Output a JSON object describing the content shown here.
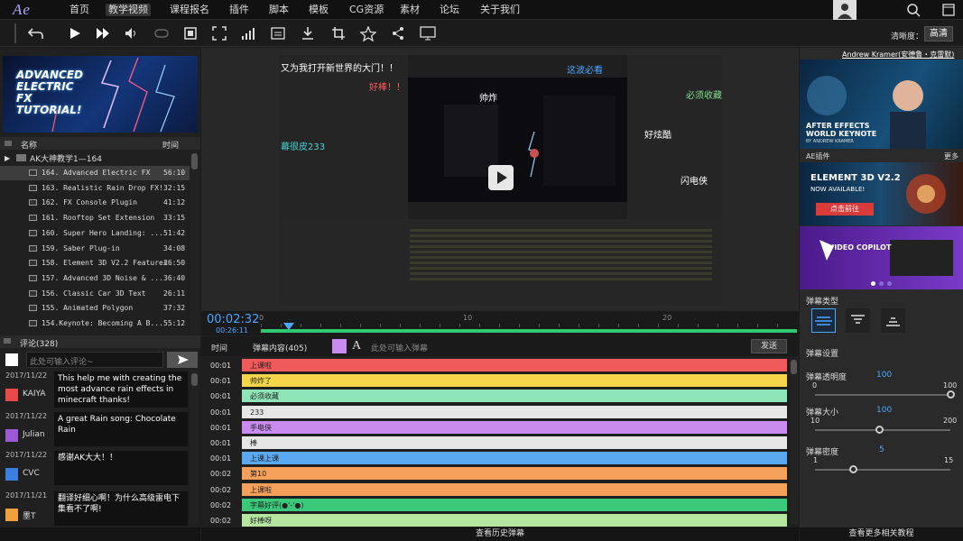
{
  "nav": {
    "logo": "Ae",
    "items": [
      "首页",
      "教学视频",
      "课程报名",
      "插件",
      "脚本",
      "模板",
      "CG资源",
      "素材",
      "论坛",
      "关于我们"
    ],
    "active": 1
  },
  "toolbar": {
    "quality_label": "清晰度：",
    "quality_value": "高清"
  },
  "left": {
    "thumb_text": "ADVANCED ELECTRIC FX TUTORIAL!",
    "list_head": {
      "name": "名称",
      "time": "时间"
    },
    "folder": "AK大神教学1—164",
    "lessons": [
      {
        "title": "164. Advanced Electric FX",
        "time": "56:10"
      },
      {
        "title": "163. Realistic Rain Drop FX!",
        "time": "32:15"
      },
      {
        "title": "162. FX Console Plugin",
        "time": "41:12"
      },
      {
        "title": "161. Rooftop Set Extension",
        "time": "33:15"
      },
      {
        "title": "160. Super Hero Landing: ...",
        "time": "51:42"
      },
      {
        "title": "159. Saber Plug-in",
        "time": "34:08"
      },
      {
        "title": "158. Element 3D V2.2 Features",
        "time": "26:50"
      },
      {
        "title": "157. Advanced 3D Noise & ...",
        "time": "36:40"
      },
      {
        "title": "156. Classic Car 3D Text",
        "time": "26:11"
      },
      {
        "title": "155. Animated Polygon",
        "time": "37:32"
      },
      {
        "title": "154.Keynote: Becoming A B...",
        "time": "55:12"
      }
    ],
    "comments_head": "评论(328)",
    "comment_placeholder": "此处可输入评论~",
    "comments": [
      {
        "date": "2017/11/22",
        "user": "KAIYA",
        "color": "#e84a4a",
        "text": "This help me with creating the most advance rain effects in minecraft thanks!"
      },
      {
        "date": "2017/11/22",
        "user": "Julian",
        "color": "#9b59d6",
        "text": "A great Rain song: Chocolate Rain"
      },
      {
        "date": "2017/11/22",
        "user": "CVC",
        "color": "#3a7ee0",
        "text": "感谢AK大大！！"
      },
      {
        "date": "2017/11/21",
        "user": "墨T",
        "color": "#f0a03a",
        "text": "翻译好细心啊！为什么高级雷电下集看不了啊!"
      }
    ]
  },
  "video": {
    "danmaku": [
      {
        "text": "又为我打开新世界的大门！！",
        "color": "#fff"
      },
      {
        "text": "这波必看",
        "color": "#4aa6ff"
      },
      {
        "text": "好棒！！",
        "color": "#ff5a5a"
      },
      {
        "text": "帅炸",
        "color": "#fff"
      },
      {
        "text": "必须收藏",
        "color": "#7fe08a"
      },
      {
        "text": "幕很皮233",
        "color": "#4ad4d4"
      },
      {
        "text": "好炫酷",
        "color": "#fff"
      },
      {
        "text": "闪电侠",
        "color": "#fff"
      }
    ]
  },
  "timeline": {
    "current": "00:02:32",
    "total": "00:26:11",
    "ticks": [
      "0",
      "10",
      "20"
    ]
  },
  "danmaku_list": {
    "col_time": "时间",
    "col_content": "弹幕内容(405)",
    "input_placeholder": "此处可输入弹幕",
    "send": "发送",
    "font_glyph": "A",
    "rows": [
      {
        "t": "00:01",
        "text": "上课啦",
        "color": "#f05a5a"
      },
      {
        "t": "00:01",
        "text": "帅炸了",
        "color": "#f5d64a"
      },
      {
        "t": "00:01",
        "text": "必须收藏",
        "color": "#8ee6b8"
      },
      {
        "t": "00:01",
        "text": "233",
        "color": "#e6e6e6"
      },
      {
        "t": "00:01",
        "text": "手电侠",
        "color": "#c98bf0"
      },
      {
        "t": "00:01",
        "text": "棒",
        "color": "#e6e6e6"
      },
      {
        "t": "00:01",
        "text": "上课上课",
        "color": "#5aa8f0"
      },
      {
        "t": "00:02",
        "text": "第10",
        "color": "#f5a05a"
      },
      {
        "t": "00:02",
        "text": "上课啦",
        "color": "#f5a05a"
      },
      {
        "t": "00:02",
        "text": "字幕好评(●'-'●)",
        "color": "#3ac97a"
      },
      {
        "t": "00:02",
        "text": "好棒呀",
        "color": "#b4e6a0"
      }
    ],
    "history": "查看历史弹幕"
  },
  "right": {
    "author": "Andrew Kramer(安德鲁・克雷默)",
    "ad1": "AFTER EFFECTS WORLD KEYNOTE",
    "ad1_sub": "BY ANDREW KRAMER",
    "plugins_label": "AE插件",
    "more": "更多",
    "ad2_title": "ELEMENT 3D V2.2",
    "ad2_sub": "NOW AVAILABLE!",
    "ad2_btn": "点击前往",
    "ad3_title": "VIDEO COPILOT",
    "danmaku_type": "弹幕类型",
    "danmaku_settings": "弹幕设置",
    "opacity": {
      "label": "弹幕透明度",
      "value": "100",
      "min": "0",
      "max": "100",
      "frac": 1.0
    },
    "size": {
      "label": "弹幕大小",
      "value": "100",
      "min": "10",
      "max": "200",
      "frac": 0.47
    },
    "density": {
      "label": "弹幕密度",
      "value": "5",
      "min": "1",
      "max": "15",
      "frac": 0.28
    },
    "related": "查看更多相关教程"
  }
}
